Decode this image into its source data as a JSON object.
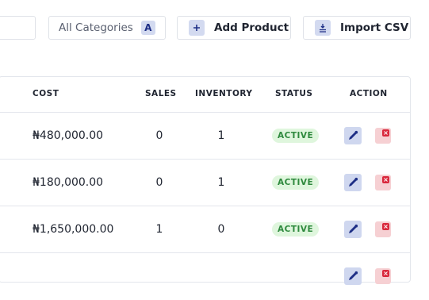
{
  "toolbar": {
    "categories_label": "All Categories",
    "categories_badge": "A",
    "add_product_label": "Add Product",
    "import_csv_label": "Import CSV"
  },
  "table": {
    "columns": [
      "COST",
      "SALES",
      "INVENTORY",
      "STATUS",
      "ACTION"
    ],
    "rows": [
      {
        "cost": "₦480,000.00",
        "sales": "0",
        "inventory": "1",
        "status": "ACTIVE"
      },
      {
        "cost": "₦180,000.00",
        "sales": "0",
        "inventory": "1",
        "status": "ACTIVE"
      },
      {
        "cost": "₦1,650,000.00",
        "sales": "1",
        "inventory": "0",
        "status": "ACTIVE"
      }
    ]
  },
  "colors": {
    "accent": "#1e2f86",
    "accent_soft": "#d3daf0",
    "status_active_bg": "#dff6dd",
    "status_active_text": "#2f8a3e",
    "delete_soft": "#f6d0d3",
    "delete": "#d9293d"
  },
  "icons": {
    "add": "plus-icon",
    "import": "import-icon",
    "edit": "pencil-icon",
    "delete": "close-icon"
  }
}
